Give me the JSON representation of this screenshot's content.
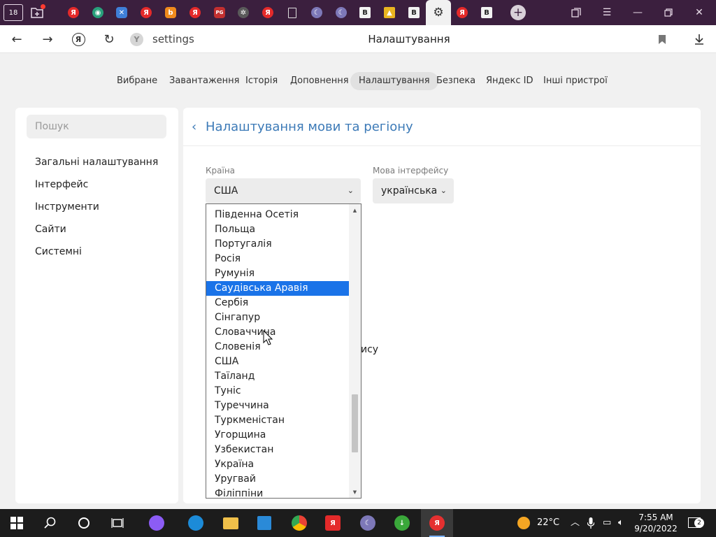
{
  "browser": {
    "home_badge": "18",
    "pg_badge": "PG",
    "ya_letter": "Я",
    "b_letter": "B",
    "plus": "+",
    "url": "settings",
    "title": "Налаштування",
    "site_icon_letter": "Y"
  },
  "topnav": {
    "items": [
      "Вибране",
      "Завантаження",
      "Історія",
      "Доповнення",
      "Налаштування",
      "Безпека",
      "Яндекс ID",
      "Інші пристрої"
    ],
    "active": "Налаштування"
  },
  "sidebar": {
    "search_placeholder": "Пошук",
    "items": [
      "Загальні налаштування",
      "Інтерфейс",
      "Інструменти",
      "Сайти",
      "Системні"
    ]
  },
  "section": {
    "title": "Налаштування мови та регіону",
    "country_label": "Країна",
    "country_value": "США",
    "language_label": "Мова інтерфейсу",
    "language_value": "українська",
    "partial_text": "ису"
  },
  "dropdown": {
    "options": [
      "Південна Осетія",
      "Польща",
      "Португалія",
      "Росія",
      "Румунія",
      "Саудівська Аравія",
      "Сербія",
      "Сінгапур",
      "Словаччина",
      "Словенія",
      "США",
      "Таїланд",
      "Туніс",
      "Туреччина",
      "Туркменістан",
      "Угорщина",
      "Узбекистан",
      "Україна",
      "Уругвай",
      "Філіппіни"
    ],
    "highlighted": "Саудівська Аравія"
  },
  "taskbar": {
    "temperature": "22°C",
    "time": "7:55 AM",
    "date": "9/20/2022",
    "notification_count": "2"
  },
  "colors": {
    "tab_strip": "#3b1f3e",
    "accent_link": "#3c7ab7",
    "selection": "#1a73e8",
    "taskbar": "#1c1c1c"
  }
}
